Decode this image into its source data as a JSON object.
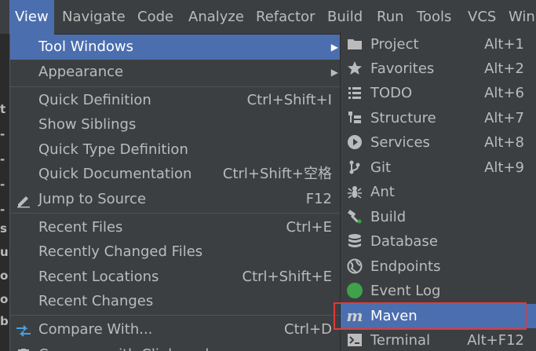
{
  "menubar": {
    "items": [
      {
        "label": "View",
        "active": true
      },
      {
        "label": "Navigate"
      },
      {
        "label": "Code"
      },
      {
        "label": "Analyze"
      },
      {
        "label": "Refactor"
      },
      {
        "label": "Build"
      },
      {
        "label": "Run"
      },
      {
        "label": "Tools"
      },
      {
        "label": "VCS"
      },
      {
        "label": "Win"
      }
    ]
  },
  "editor_strip": {
    "chars": [
      "t",
      "-",
      "-",
      "-",
      "-",
      "s",
      "u",
      "o",
      "o",
      "b"
    ]
  },
  "view_menu": {
    "items": [
      {
        "label": "Tool Windows",
        "submenu": true,
        "selected": true
      },
      {
        "label": "Appearance",
        "submenu": true
      },
      {
        "label": "Quick Definition",
        "shortcut": "Ctrl+Shift+I"
      },
      {
        "label": "Show Siblings"
      },
      {
        "label": "Quick Type Definition"
      },
      {
        "label": "Quick Documentation",
        "shortcut": "Ctrl+Shift+空格"
      },
      {
        "label": "Jump to Source",
        "shortcut": "F12",
        "icon": "pencil-icon"
      },
      {
        "label": "Recent Files",
        "shortcut": "Ctrl+E"
      },
      {
        "label": "Recently Changed Files"
      },
      {
        "label": "Recent Locations",
        "shortcut": "Ctrl+Shift+E"
      },
      {
        "label": "Recent Changes"
      },
      {
        "label": "Compare With...",
        "shortcut": "Ctrl+D",
        "icon": "compare-arrows-icon"
      },
      {
        "label": "Compare with Clipboard",
        "icon": "clipboard-icon"
      }
    ]
  },
  "tool_windows_submenu": {
    "items": [
      {
        "label": "Project",
        "shortcut": "Alt+1",
        "icon": "folder-icon"
      },
      {
        "label": "Favorites",
        "shortcut": "Alt+2",
        "icon": "star-icon"
      },
      {
        "label": "TODO",
        "shortcut": "Alt+6",
        "icon": "list-icon"
      },
      {
        "label": "Structure",
        "shortcut": "Alt+7",
        "icon": "structure-icon"
      },
      {
        "label": "Services",
        "shortcut": "Alt+8",
        "icon": "play-circle-icon"
      },
      {
        "label": "Git",
        "shortcut": "Alt+9",
        "icon": "git-branch-icon"
      },
      {
        "label": "Ant",
        "shortcut": "",
        "icon": "ant-icon"
      },
      {
        "label": "Build",
        "shortcut": "",
        "icon": "hammer-icon"
      },
      {
        "label": "Database",
        "shortcut": "",
        "icon": "database-icon"
      },
      {
        "label": "Endpoints",
        "shortcut": "",
        "icon": "globe-icon"
      },
      {
        "label": "Event Log",
        "shortcut": "",
        "icon": "event-log-icon"
      },
      {
        "label": "Maven",
        "shortcut": "",
        "icon": "maven-icon",
        "selected": true
      },
      {
        "label": "Terminal",
        "shortcut": "Alt+F12",
        "icon": "terminal-icon"
      }
    ]
  },
  "colors": {
    "selection": "#4b6eaf",
    "background": "#3c3f41",
    "highlight_box": "#e03a3a",
    "event_log_green": "#3fa14a"
  }
}
